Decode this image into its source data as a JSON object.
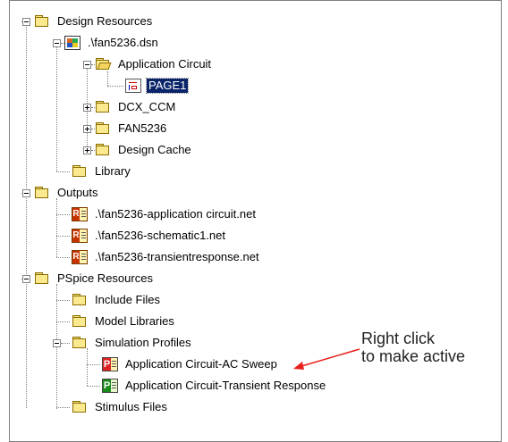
{
  "tree": {
    "design_resources": "Design Resources",
    "dsn_file": ".\\fan5236.dsn",
    "application_circuit": "Application Circuit",
    "page1": "PAGE1",
    "dcx_ccm": "DCX_CCM",
    "fan5236": "FAN5236",
    "design_cache": "Design Cache",
    "library": "Library",
    "outputs": "Outputs",
    "net_application": ".\\fan5236-application circuit.net",
    "net_schematic": ".\\fan5236-schematic1.net",
    "net_transient": ".\\fan5236-transientresponse.net",
    "pspice_resources": "PSpice Resources",
    "include_files": "Include Files",
    "model_libraries": "Model Libraries",
    "simulation_profiles": "Simulation Profiles",
    "profile_ac_sweep": "Application Circuit-AC Sweep",
    "profile_transient": "Application Circuit-Transient Response",
    "stimulus_files": "Stimulus Files"
  },
  "annotation": {
    "line1": "Right click",
    "line2": "to make active",
    "arrow_color": "#e8201a"
  },
  "icons": {
    "folder": "folder-icon",
    "folder_open": "folder-open-icon",
    "design": "design-file-icon",
    "page": "schematic-page-icon",
    "netlist": "netlist-file-icon",
    "profile": "simulation-profile-icon"
  }
}
